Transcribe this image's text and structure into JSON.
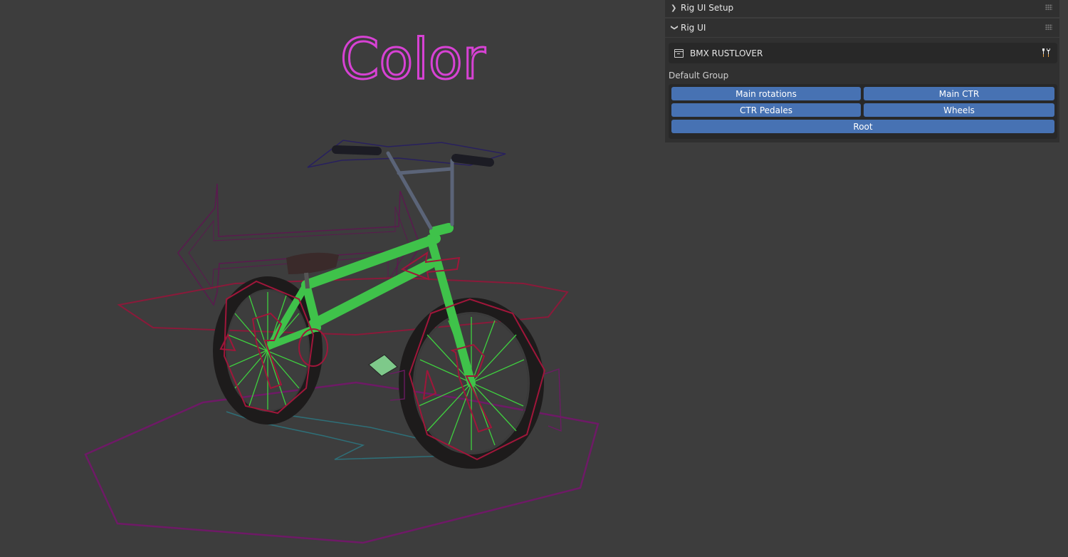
{
  "viewport": {
    "overlay_text": "Color",
    "overlay_text_color": "#d742d4",
    "background_color": "#3d3d3d"
  },
  "sidebar": {
    "panels": [
      {
        "title": "Rig UI Setup",
        "expanded": false,
        "chevron_icon": "chevron-right-icon"
      },
      {
        "title": "Rig UI",
        "expanded": true,
        "chevron_icon": "chevron-down-icon"
      }
    ],
    "rig_name": "BMX RUSTLOVER",
    "rig_icon": "archive-icon",
    "settings_icon": "tools-icon",
    "group_label": "Default Group",
    "buttons": {
      "main_rotations": "Main rotations",
      "main_ctr": "Main CTR",
      "ctr_pedales": "CTR Pedales",
      "wheels": "Wheels",
      "root": "Root"
    },
    "button_color": "#4772b3"
  }
}
